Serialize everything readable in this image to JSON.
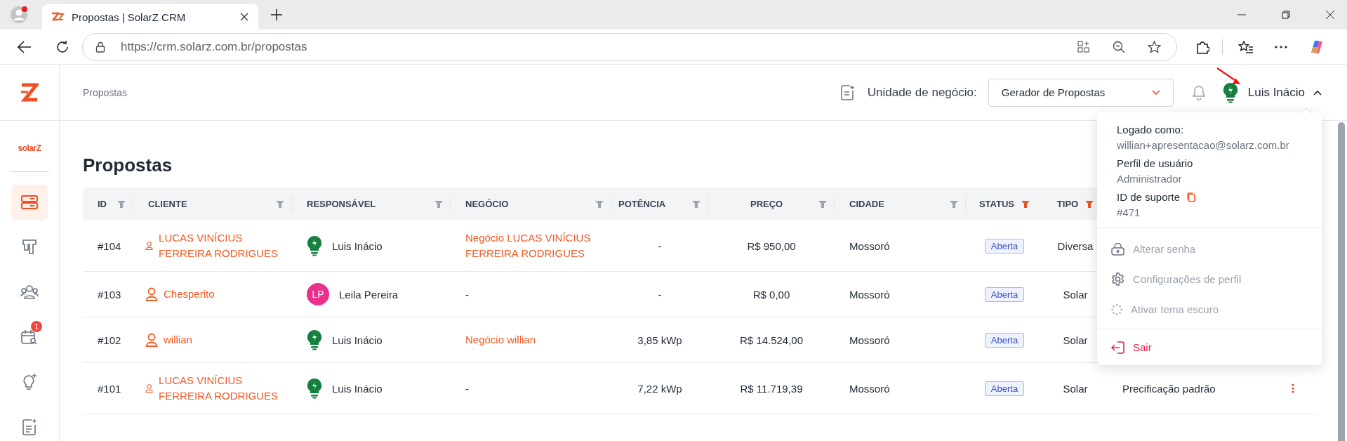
{
  "browser": {
    "tab_title": "Propostas | SolarZ CRM",
    "url": "https://crm.solarz.com.br/propostas"
  },
  "sidebar": {
    "brand": "solarZ",
    "items": [
      {
        "selected": true
      },
      {
        "selected": false
      },
      {
        "selected": false
      },
      {
        "selected": false,
        "badge": "1"
      },
      {
        "selected": false
      },
      {
        "selected": false
      }
    ]
  },
  "header": {
    "breadcrumb": "Propostas",
    "unit_label": "Unidade de negócio:",
    "unit_value": "Gerador de Propostas",
    "user_name": "Luis Inácio",
    "menu_expanded": true
  },
  "page_title": "Propostas",
  "table": {
    "columns": [
      {
        "label": "ID",
        "filtered": false
      },
      {
        "label": "CLIENTE",
        "filtered": false
      },
      {
        "label": "RESPONSÁVEL",
        "filtered": false
      },
      {
        "label": "NEGÓCIO",
        "filtered": false
      },
      {
        "label": "POTÊNCIA",
        "filtered": false
      },
      {
        "label": "PREÇO",
        "filtered": false
      },
      {
        "label": "CIDADE",
        "filtered": false
      },
      {
        "label": "STATUS",
        "filtered": true
      },
      {
        "label": "TIPO",
        "filtered": true
      }
    ],
    "rows": [
      {
        "id": "#104",
        "client": "LUCAS VINÍCIUS FERREIRA RODRIGUES",
        "owner": {
          "kind": "bulb",
          "name": "Luis Inácio"
        },
        "deal": {
          "text": "Negócio LUCAS VINÍCIUS FERREIRA RODRIGUES",
          "link": true
        },
        "power": "-",
        "price": "R$ 950,00",
        "city": "Mossoró",
        "status": "Aberta",
        "type": "Diversa"
      },
      {
        "id": "#103",
        "client": "Chesperito",
        "owner": {
          "kind": "initials",
          "initials": "LP",
          "name": "Leila Pereira"
        },
        "deal": {
          "text": "-",
          "link": false
        },
        "power": "-",
        "price": "R$ 0,00",
        "city": "Mossoró",
        "status": "Aberta",
        "type": "Solar"
      },
      {
        "id": "#102",
        "client": "willian",
        "owner": {
          "kind": "bulb",
          "name": "Luis Inácio"
        },
        "deal": {
          "text": "Negócio willian",
          "link": true
        },
        "power": "3,85 kWp",
        "price": "R$ 14.524,00",
        "city": "Mossoró",
        "status": "Aberta",
        "type": "Solar"
      },
      {
        "id": "#101",
        "client": "LUCAS VINÍCIUS FERREIRA RODRIGUES",
        "owner": {
          "kind": "bulb",
          "name": "Luis Inácio"
        },
        "deal": {
          "text": "-",
          "link": false
        },
        "power": "7,22 kWp",
        "price": "R$ 11.719,39",
        "city": "Mossoró",
        "status": "Aberta",
        "type": "Solar",
        "column_10": "Precificação padrão",
        "menu": true
      }
    ]
  },
  "user_menu": {
    "logged_label": "Logado como:",
    "email": "willian+apresentacao@solarz.com.br",
    "profile_label": "Perfil de usuário",
    "profile_value": "Administrador",
    "support_label": "ID de suporte",
    "support_value": "#471",
    "items": [
      {
        "kind": "lock",
        "label": "Alterar senha"
      },
      {
        "kind": "gear",
        "label": "Configurações de perfil"
      },
      {
        "kind": "theme",
        "label": "Ativar tema escuro"
      }
    ],
    "logout": "Sair"
  }
}
